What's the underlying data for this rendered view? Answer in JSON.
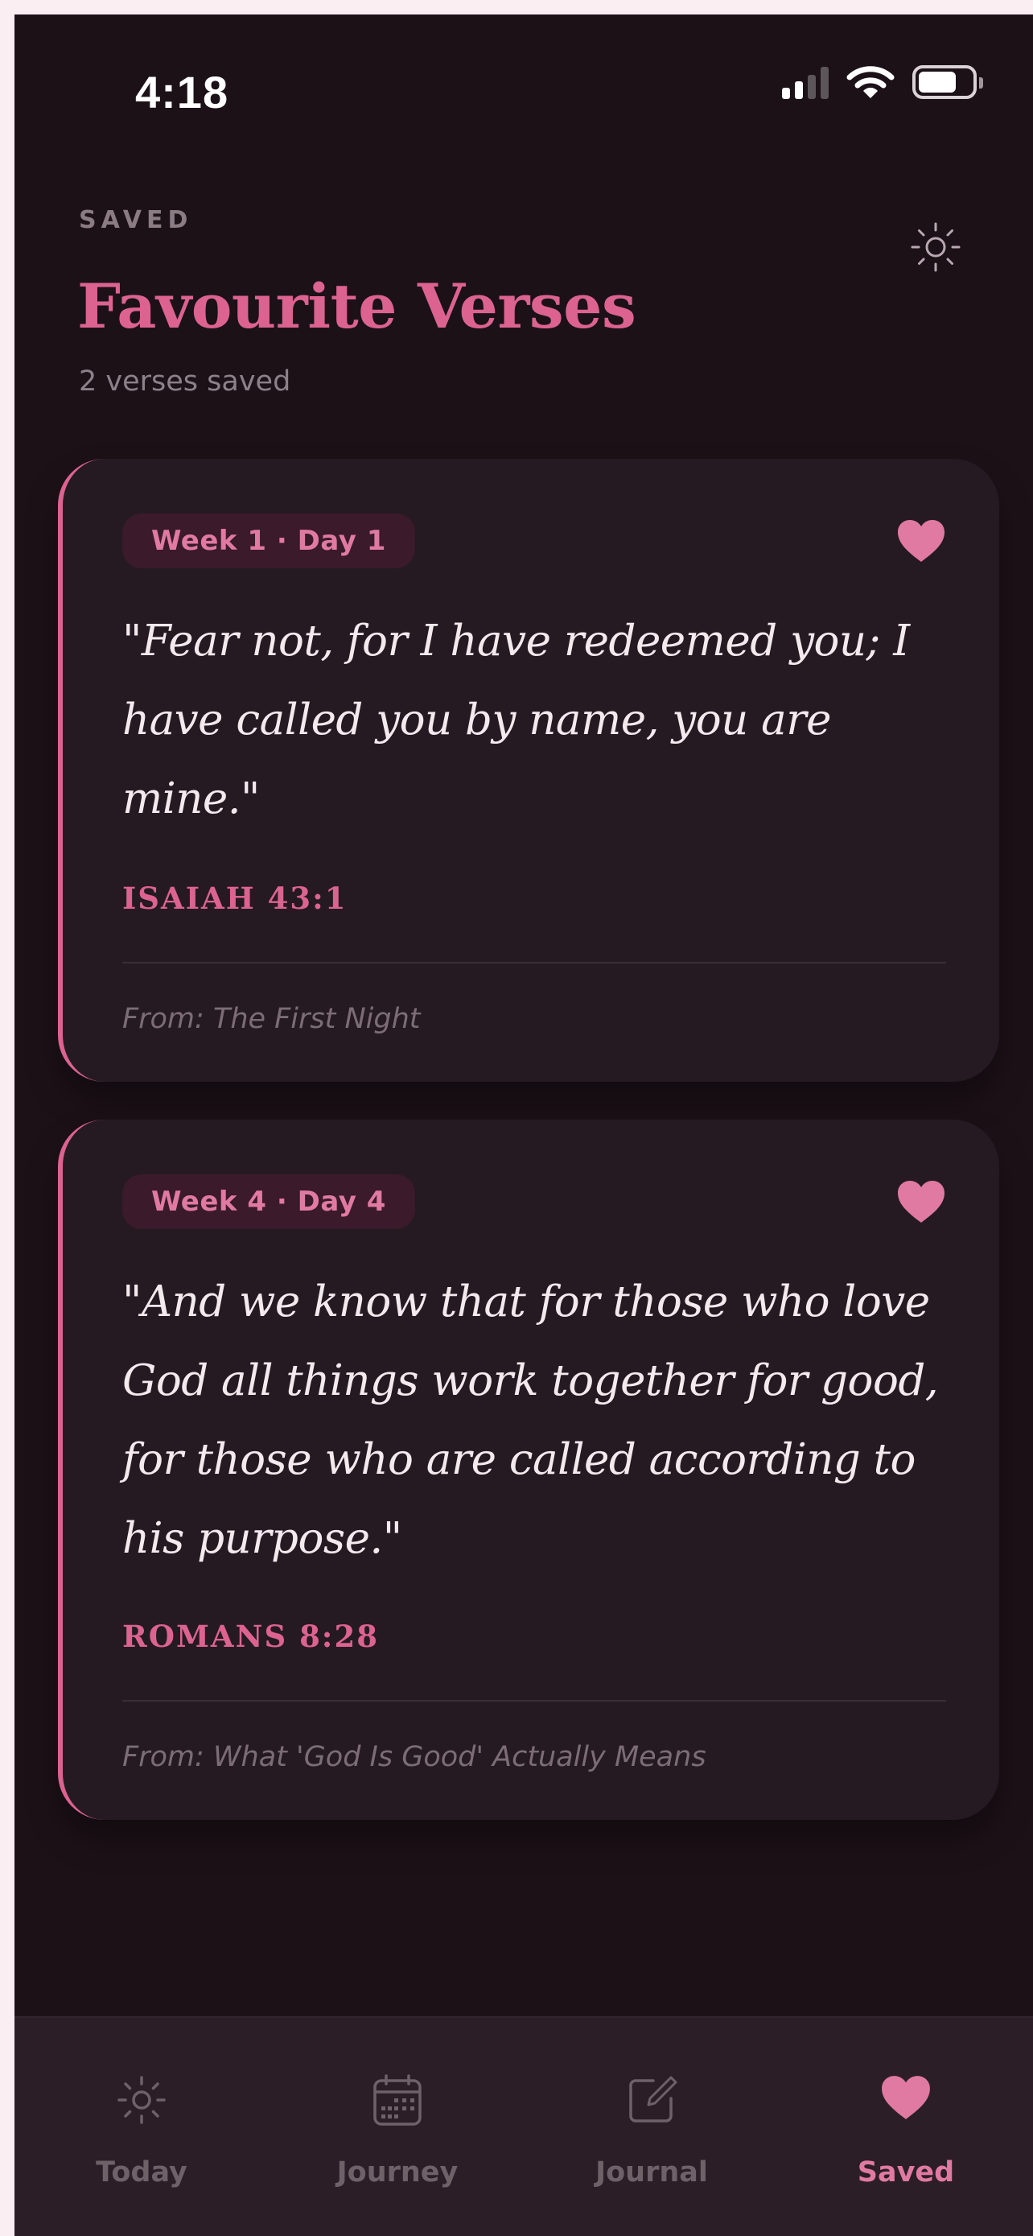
{
  "status_bar": {
    "time": "4:18"
  },
  "header": {
    "eyebrow": "SAVED",
    "title": "Favourite Verses",
    "subtitle": "2 verses saved"
  },
  "verses": [
    {
      "badge": "Week 1 · Day 1",
      "text": "\"Fear not, for I have redeemed you; I have called you by name, you are mine.\"",
      "reference": "ISAIAH 43:1",
      "source": "From: The First Night"
    },
    {
      "badge": "Week 4 · Day 4",
      "text": "\"And we know that for those who love God all things work together for good, for those who are called according to his purpose.\"",
      "reference": "ROMANS 8:28",
      "source": "From: What 'God Is Good' Actually Means"
    }
  ],
  "tabs": [
    {
      "label": "Today",
      "icon": "sun-icon",
      "active": false
    },
    {
      "label": "Journey",
      "icon": "calendar-icon",
      "active": false
    },
    {
      "label": "Journal",
      "icon": "edit-icon",
      "active": false
    },
    {
      "label": "Saved",
      "icon": "heart-icon",
      "active": true
    }
  ],
  "colors": {
    "accent": "#dc6390",
    "background": "#1c1117",
    "card": "#261a22",
    "tabbar": "#2c1e26"
  }
}
